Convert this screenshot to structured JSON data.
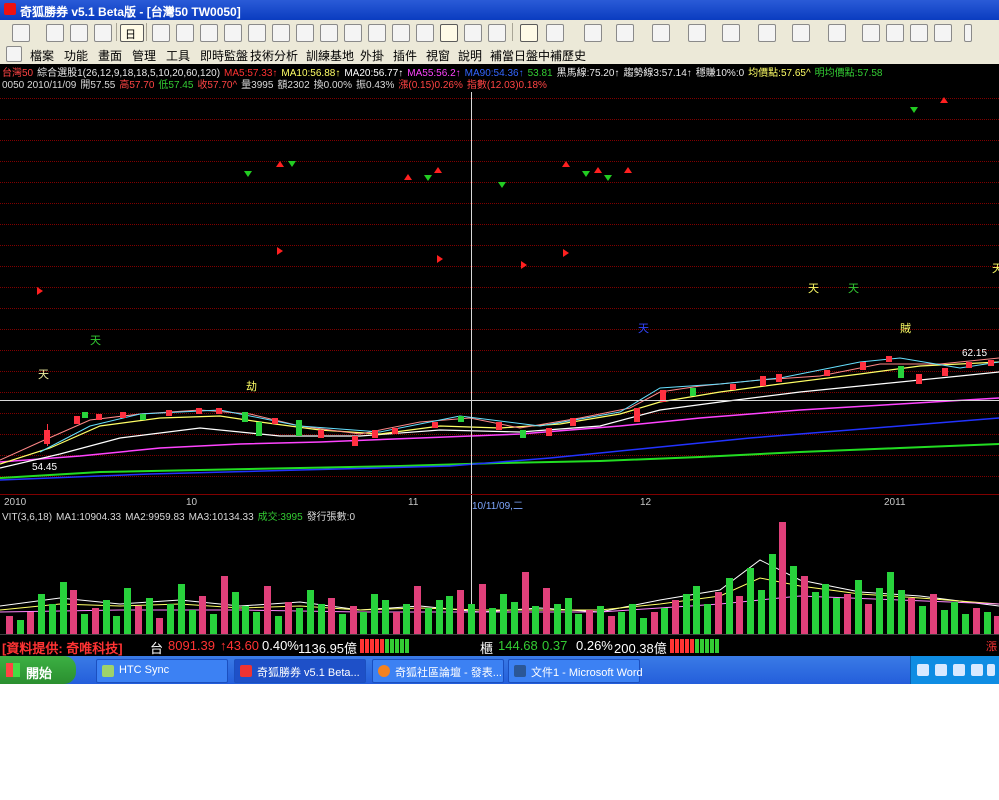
{
  "window": {
    "title": "奇狐勝券 v5.1 Beta版 - [台灣50 TW0050]"
  },
  "menu": [
    {
      "label": "檔案"
    },
    {
      "label": "功能"
    },
    {
      "label": "畫面"
    },
    {
      "label": "管理"
    },
    {
      "label": "工具"
    },
    {
      "label": "即時監盤"
    },
    {
      "label": "技術分析"
    },
    {
      "label": "訓練基地"
    },
    {
      "label": "外掛"
    },
    {
      "label": "插件"
    },
    {
      "label": "視窗"
    },
    {
      "label": "說明"
    },
    {
      "label": "補當日盤中"
    },
    {
      "label": "補歷史"
    }
  ],
  "toolbar": {
    "period_select": "日"
  },
  "indicators": {
    "line1": [
      {
        "text": "台灣50",
        "color": "#ff4444"
      },
      {
        "text": "綜合選股1(26,12,9,18,18,5,10,20,60,120)",
        "color": "#e8e8e8"
      },
      {
        "text": "MA5:57.33↑",
        "color": "#ff3333"
      },
      {
        "text": "MA10:56.88↑",
        "color": "#ffff66"
      },
      {
        "text": "MA20:56.77↑",
        "color": "#ffffff"
      },
      {
        "text": "MA55:56.2↑",
        "color": "#ff44ff"
      },
      {
        "text": "MA90:54.36↑",
        "color": "#3366ff"
      },
      {
        "text": "53.81",
        "color": "#33cc33"
      },
      {
        "text": "黑馬線:75.20↑",
        "color": "#e8e8e8"
      },
      {
        "text": "趨勢線3:57.14↑",
        "color": "#e8e8e8"
      },
      {
        "text": "穩賺10%:0",
        "color": "#e8e8e8"
      },
      {
        "text": "均價點:57.65^",
        "color": "#ffff66"
      },
      {
        "text": "明均價點:57.58",
        "color": "#33cc33"
      }
    ],
    "line2": [
      {
        "text": "0050 2010/11/09",
        "color": "#d8d8d8"
      },
      {
        "text": "開57.55",
        "color": "#d8d8d8"
      },
      {
        "text": "高57.70",
        "color": "#ff4444"
      },
      {
        "text": "低57.45",
        "color": "#33cc33"
      },
      {
        "text": "收57.70^",
        "color": "#ff4444"
      },
      {
        "text": "量3995",
        "color": "#d8d8d8"
      },
      {
        "text": "額2302",
        "color": "#d8d8d8"
      },
      {
        "text": "換0.00%",
        "color": "#d8d8d8"
      },
      {
        "text": "振0.43%",
        "color": "#d8d8d8"
      },
      {
        "text": "漲(0.15)0.26%",
        "color": "#ff4444"
      },
      {
        "text": "指數(12.03)0.18%",
        "color": "#ff4444"
      }
    ]
  },
  "chart": {
    "price_low_label": "54.45",
    "price_high_label": "62.15",
    "date_axis": [
      {
        "label": "2010"
      },
      {
        "label": "10"
      },
      {
        "label": "11"
      },
      {
        "label": "10/11/09,二"
      },
      {
        "label": "12"
      },
      {
        "label": "2011"
      }
    ],
    "annotations": [
      {
        "text": "天",
        "color": "#f0f0a0"
      },
      {
        "text": "天",
        "color": "#33cc33"
      },
      {
        "text": "劫",
        "color": "#ffff66"
      },
      {
        "text": "天",
        "color": "#3344ff"
      },
      {
        "text": "天",
        "color": "#ffff66"
      },
      {
        "text": "天",
        "color": "#33cc33"
      },
      {
        "text": "賊",
        "color": "#ffff66"
      },
      {
        "text": "天",
        "color": "#ffff66"
      }
    ]
  },
  "volume": {
    "label_parts": [
      {
        "text": "VIT(3,6,18)",
        "color": "#d8d8d8"
      },
      {
        "text": "MA1:10904.33",
        "color": "#d8d8d8"
      },
      {
        "text": "MA2:9959.83",
        "color": "#d8d8d8"
      },
      {
        "text": "MA3:10134.33",
        "color": "#d8d8d8"
      },
      {
        "text": "成交:3995",
        "color": "#33cc33"
      },
      {
        "text": "發行張數:0",
        "color": "#d8d8d8"
      }
    ]
  },
  "status": {
    "source": "[資料提供: 奇唯科技]",
    "index_label": "台",
    "index_value": "8091.39",
    "index_change": "↑43.60",
    "index_pct": "0.40%",
    "index_amount": "1136.95億",
    "otc_label": "櫃",
    "otc_value": "144.68",
    "otc_change": "0.37",
    "otc_pct": "0.26%",
    "otc_amount": "200.38億",
    "right_tag": "漲"
  },
  "taskbar": {
    "start": "開始",
    "tasks": [
      {
        "label": "HTC Sync"
      },
      {
        "label": "奇狐勝券 v5.1 Beta..."
      },
      {
        "label": "奇狐社區論壇 - 發表..."
      },
      {
        "label": "文件1 - Microsoft Word"
      }
    ]
  },
  "colors": {
    "up": "#ff3040",
    "down": "#28d23c",
    "grid": "#800000",
    "background": "#000000"
  }
}
